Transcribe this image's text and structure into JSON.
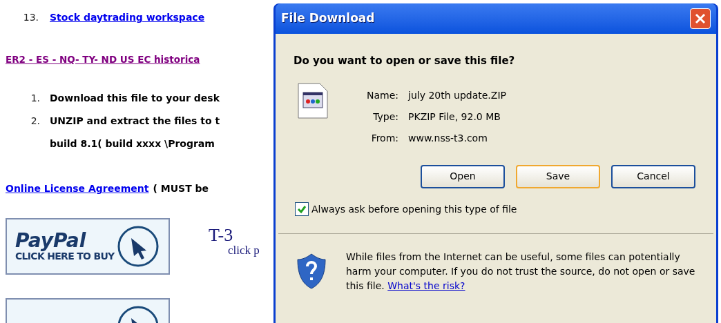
{
  "page": {
    "numbered_link": {
      "number": "13.",
      "label": "Stock daytrading workspace"
    },
    "section_link": "ER2 - ES - NQ- TY- ND US EC  historica",
    "steps": [
      {
        "number": "1.",
        "lines": [
          "Download this file to your desk"
        ]
      },
      {
        "number": "2.",
        "lines": [
          "UNZIP and extract the files to t",
          "build 8.1( build xxxx \\Program"
        ]
      }
    ],
    "license": {
      "link": "Online License Agreement",
      "note": "( MUST be"
    },
    "buy_banner": {
      "brand": "PayPal",
      "caption": "CLICK HERE TO BUY"
    },
    "product": {
      "title": "T-3",
      "subtitle": "click p"
    }
  },
  "dialog": {
    "title": "File Download",
    "question": "Do you want to open or save this file?",
    "fields": [
      {
        "label": "Name:",
        "value": "july 20th update.ZIP"
      },
      {
        "label": "Type:",
        "value": "PKZIP File, 92.0 MB"
      },
      {
        "label": "From:",
        "value": "www.nss-t3.com"
      }
    ],
    "buttons": [
      {
        "label": "Open",
        "selected": false
      },
      {
        "label": "Save",
        "selected": true
      },
      {
        "label": "Cancel",
        "selected": false
      }
    ],
    "always_ask": {
      "label": "Always ask before opening this type of file",
      "checked": true
    },
    "warning": {
      "text": "While files from the Internet can be useful, some files can potentially harm your computer. If you do not trust the source, do not open or save this file.",
      "link": "What's the risk?"
    }
  }
}
